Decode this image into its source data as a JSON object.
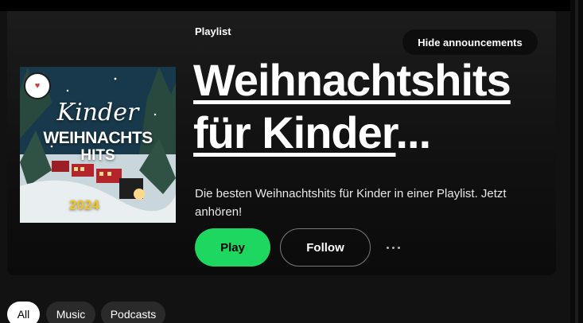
{
  "header": {
    "kicker": "Playlist",
    "hide_announcements": "Hide announcements",
    "title_main": "Weihnachtshits für Kinder",
    "title_ellipsis": "...",
    "description": "Die besten Weihnachtshits für Kinder in einer Playlist. Jetzt anhören!"
  },
  "cover": {
    "line1": "Kinder",
    "line2": "WEIHNACHTS",
    "line3": "HITS",
    "year": "2024",
    "badge_icon": "heart-badge-icon"
  },
  "actions": {
    "play_label": "Play",
    "follow_label": "Follow",
    "more_icon": "more-options-icon"
  },
  "filters": [
    {
      "label": "All",
      "active": true
    },
    {
      "label": "Music",
      "active": false
    },
    {
      "label": "Podcasts",
      "active": false
    }
  ],
  "colors": {
    "accent": "#1ed760",
    "background": "#121212",
    "year_text": "#f5c518"
  }
}
